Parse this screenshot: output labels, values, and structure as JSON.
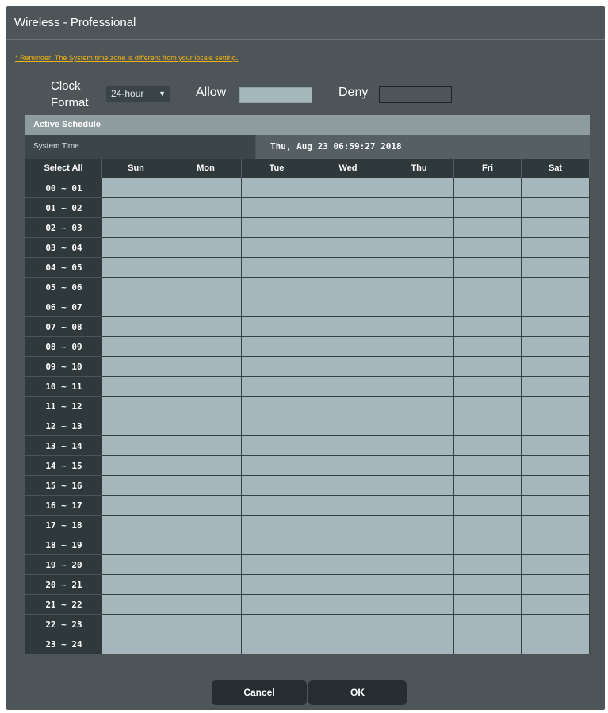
{
  "page": {
    "title": "Wireless - Professional",
    "reminder": "* Reminder: The System time zone is different from your locale setting."
  },
  "clock": {
    "label": "Clock Format",
    "selected": "24-hour",
    "allow_label": "Allow",
    "deny_label": "Deny"
  },
  "schedule": {
    "header": "Active Schedule",
    "system_time_label": "System Time",
    "system_time_value": "Thu, Aug 23 06:59:27 2018",
    "select_all": "Select All",
    "days": [
      "Sun",
      "Mon",
      "Tue",
      "Wed",
      "Thu",
      "Fri",
      "Sat"
    ],
    "hours": [
      "00 ~ 01",
      "01 ~ 02",
      "02 ~ 03",
      "03 ~ 04",
      "04 ~ 05",
      "05 ~ 06",
      "06 ~ 07",
      "07 ~ 08",
      "08 ~ 09",
      "09 ~ 10",
      "10 ~ 11",
      "11 ~ 12",
      "12 ~ 13",
      "13 ~ 14",
      "14 ~ 15",
      "15 ~ 16",
      "16 ~ 17",
      "17 ~ 18",
      "18 ~ 19",
      "19 ~ 20",
      "20 ~ 21",
      "21 ~ 22",
      "22 ~ 23",
      "23 ~ 24"
    ]
  },
  "buttons": {
    "cancel": "Cancel",
    "ok": "OK"
  },
  "colors": {
    "allow": "#a5b7bc",
    "deny": "#4d5558",
    "reminder": "#f0b411",
    "panel": "#4d5558"
  },
  "icons": {
    "dropdown": "chevron-down-icon"
  }
}
